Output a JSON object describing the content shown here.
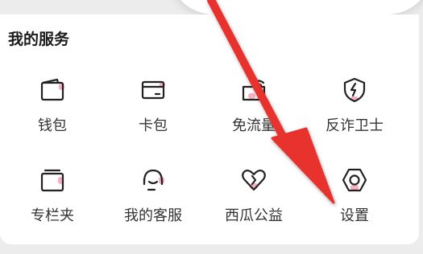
{
  "section": {
    "title": "我的服务"
  },
  "services": [
    {
      "label": "钱包",
      "icon": "wallet-icon"
    },
    {
      "label": "卡包",
      "icon": "card-icon"
    },
    {
      "label": "免流量",
      "icon": "sim-wifi-icon"
    },
    {
      "label": "反诈卫士",
      "icon": "shield-lightning-icon"
    },
    {
      "label": "专栏夹",
      "icon": "folder-icon"
    },
    {
      "label": "我的客服",
      "icon": "headset-icon"
    },
    {
      "label": "西瓜公益",
      "icon": "heart-icon"
    },
    {
      "label": "设置",
      "icon": "hexagon-settings-icon"
    }
  ],
  "colors": {
    "accent": "#f3a3b7",
    "arrow": "#e8312f",
    "text": "#333333"
  }
}
